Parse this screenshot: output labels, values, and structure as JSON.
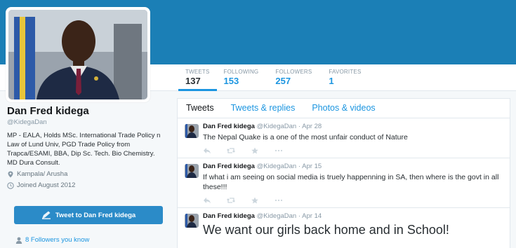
{
  "profile": {
    "name": "Dan Fred kidega",
    "handle": "@KidegaDan",
    "bio": "MP - EALA, Holds MSc. International Trade Policy n Law of Lund Univ, PGD Trade Policy from Trapca/ESAMI, BBA, Dip Sc. Tech. Bio Chemistry. MD Dura Consult.",
    "location": "Kampala/ Arusha",
    "joined": "Joined August 2012",
    "tweet_to_label": "Tweet to Dan Fred kidega",
    "followers_you_know": "8 Followers you know"
  },
  "stats": [
    {
      "label": "TWEETS",
      "value": "137"
    },
    {
      "label": "FOLLOWING",
      "value": "153"
    },
    {
      "label": "FOLLOWERS",
      "value": "257"
    },
    {
      "label": "FAVORITES",
      "value": "1"
    }
  ],
  "tabs": [
    "Tweets",
    "Tweets & replies",
    "Photos & videos"
  ],
  "tweets": [
    {
      "name": "Dan Fred kidega",
      "handle": "@KidegaDan",
      "dot": "·",
      "date": "Apr 28",
      "text": "The Nepal Quake is a one of the most unfair conduct of Nature"
    },
    {
      "name": "Dan Fred kidega",
      "handle": "@KidegaDan",
      "dot": "·",
      "date": "Apr 15",
      "text": "If what i am seeing on social media is truely happenning in SA, then where is the govt in all these!!!"
    },
    {
      "name": "Dan Fred kidega",
      "handle": "@KidegaDan",
      "dot": "·",
      "date": "Apr 14",
      "text": "We want our girls back home and in School!"
    }
  ],
  "colors": {
    "banner": "#1b7fb6",
    "accent": "#1b95e0",
    "button": "#2b8bc8"
  }
}
